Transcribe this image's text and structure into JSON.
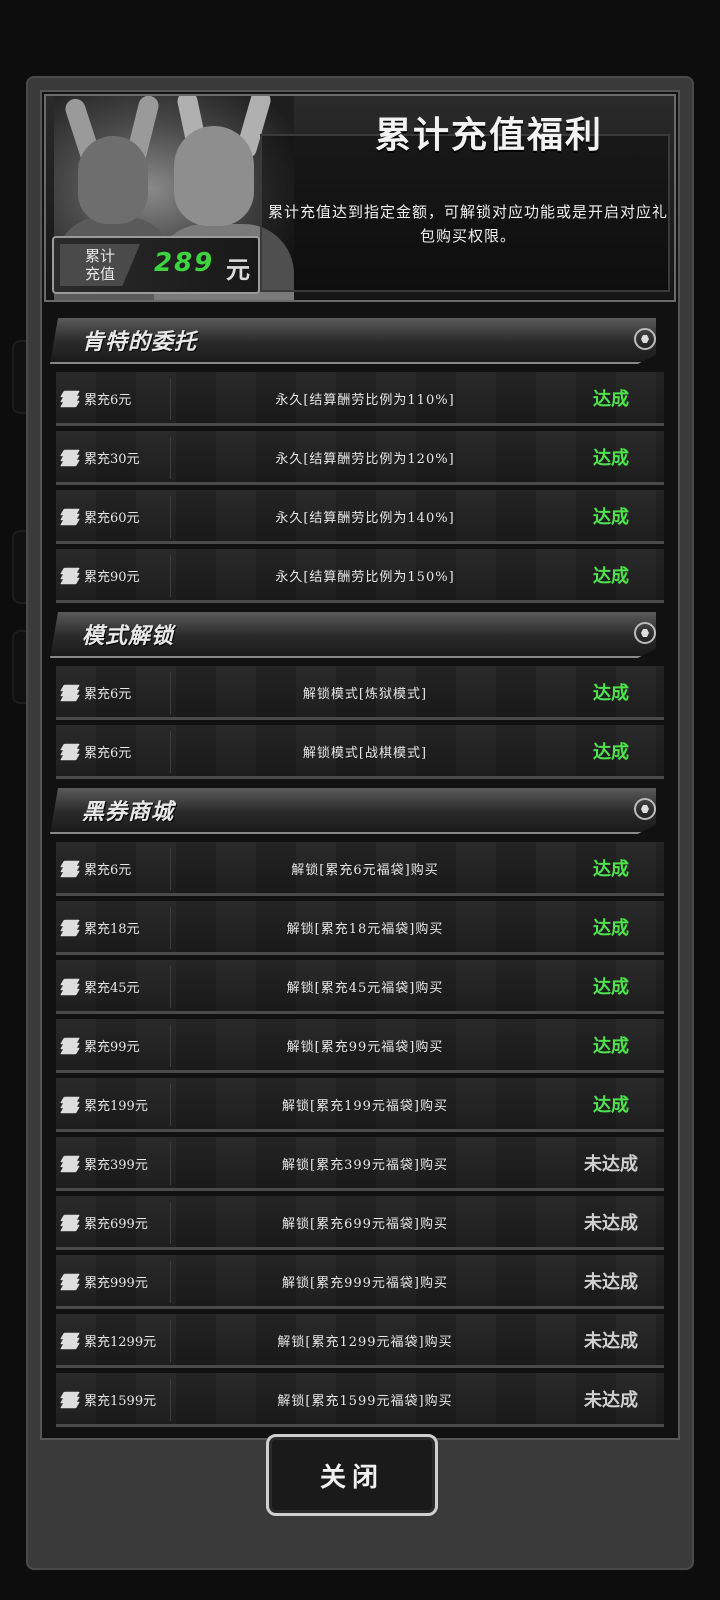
{
  "header": {
    "title": "累计充值福利",
    "description": "累计充值达到指定金额，可解锁对应功能或是开启对应礼包购买权限。",
    "total_label_line1": "累计",
    "total_label_line2": "充值",
    "total_value": "289",
    "total_unit": "元"
  },
  "colors": {
    "done": "#4ee24e",
    "not_done": "#cfcfcf",
    "total_value": "#3fd33f"
  },
  "sections": [
    {
      "title": "肯特的委托",
      "icon": "hexagon-icon",
      "rows": [
        {
          "req": "累充6元",
          "reward": "永久[结算酬劳比例为110%]",
          "status": "达成",
          "done": true
        },
        {
          "req": "累充30元",
          "reward": "永久[结算酬劳比例为120%]",
          "status": "达成",
          "done": true
        },
        {
          "req": "累充60元",
          "reward": "永久[结算酬劳比例为140%]",
          "status": "达成",
          "done": true
        },
        {
          "req": "累充90元",
          "reward": "永久[结算酬劳比例为150%]",
          "status": "达成",
          "done": true
        }
      ]
    },
    {
      "title": "模式解锁",
      "icon": "hexagon-icon",
      "rows": [
        {
          "req": "累充6元",
          "reward": "解锁模式[炼狱模式]",
          "status": "达成",
          "done": true
        },
        {
          "req": "累充6元",
          "reward": "解锁模式[战棋模式]",
          "status": "达成",
          "done": true
        }
      ]
    },
    {
      "title": "黑券商城",
      "icon": "hexagon-icon",
      "rows": [
        {
          "req": "累充6元",
          "reward": "解锁[累充6元福袋]购买",
          "status": "达成",
          "done": true
        },
        {
          "req": "累充18元",
          "reward": "解锁[累充18元福袋]购买",
          "status": "达成",
          "done": true
        },
        {
          "req": "累充45元",
          "reward": "解锁[累充45元福袋]购买",
          "status": "达成",
          "done": true
        },
        {
          "req": "累充99元",
          "reward": "解锁[累充99元福袋]购买",
          "status": "达成",
          "done": true
        },
        {
          "req": "累充199元",
          "reward": "解锁[累充199元福袋]购买",
          "status": "达成",
          "done": true
        },
        {
          "req": "累充399元",
          "reward": "解锁[累充399元福袋]购买",
          "status": "未达成",
          "done": false
        },
        {
          "req": "累充699元",
          "reward": "解锁[累充699元福袋]购买",
          "status": "未达成",
          "done": false
        },
        {
          "req": "累充999元",
          "reward": "解锁[累充999元福袋]购买",
          "status": "未达成",
          "done": false
        },
        {
          "req": "累充1299元",
          "reward": "解锁[累充1299元福袋]购买",
          "status": "未达成",
          "done": false
        },
        {
          "req": "累充1599元",
          "reward": "解锁[累充1599元福袋]购买",
          "status": "未达成",
          "done": false
        }
      ]
    }
  ],
  "footer": {
    "close_label": "关闭"
  }
}
